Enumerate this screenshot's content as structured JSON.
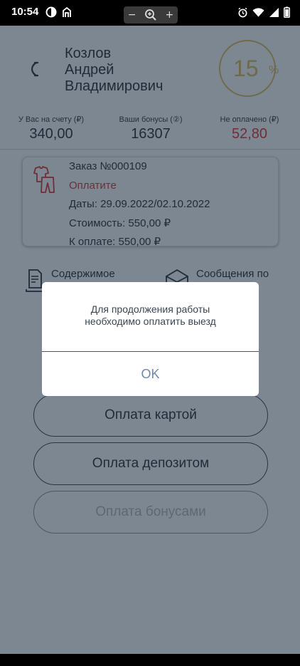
{
  "status_bar": {
    "time": "10:54",
    "zoom_minus": "−",
    "zoom_plus": "+"
  },
  "profile": {
    "name_line1": "Козлов",
    "name_line2": "Андрей",
    "name_line3": "Владимирович",
    "discount_value": "15",
    "discount_unit": "%"
  },
  "stats": {
    "balance_label": "У Вас на счету (₽)",
    "balance_value": "340,00",
    "bonus_label": "Ваши бонусы (②)",
    "bonus_value": "16307",
    "unpaid_label": "Не оплачено (₽)",
    "unpaid_value": "52,80"
  },
  "order": {
    "number": "Заказ №000109",
    "status": "Оплатите",
    "dates": "Даты: 29.09.2022/02.10.2022",
    "cost": "Стоимость: 550,00 ₽",
    "to_pay": "К оплате: 550,00 ₽"
  },
  "actions": {
    "contents": "Содержимое",
    "messages": "Сообщения по"
  },
  "payment_buttons": {
    "card": "Оплата картой",
    "deposit": "Оплата депозитом",
    "bonus": "Оплата бонусами"
  },
  "dialog": {
    "message_line1": "Для продолжения работы",
    "message_line2": "необходимо оплатить выезд",
    "ok": "OK"
  }
}
